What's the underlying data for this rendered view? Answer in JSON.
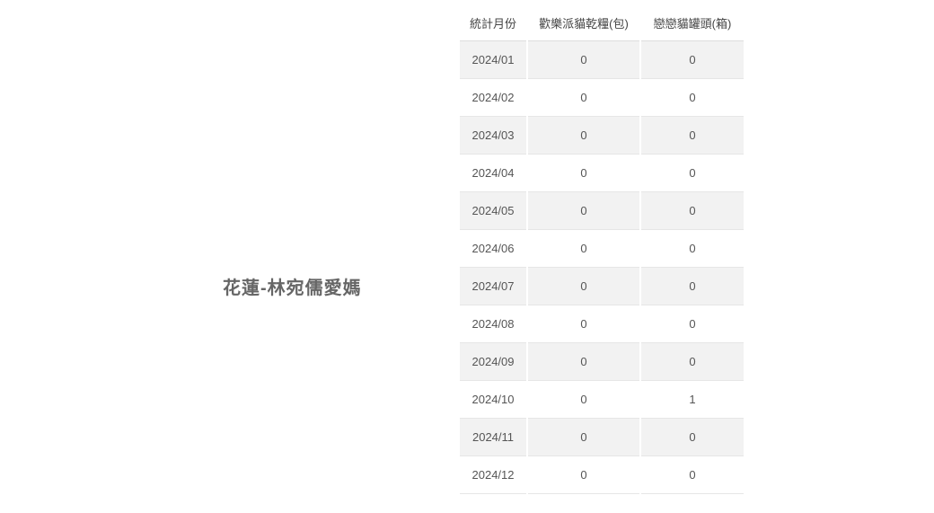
{
  "donor": {
    "name": "花蓮-林宛儒愛媽"
  },
  "table": {
    "headers": {
      "month": "統計月份",
      "dry_food": "歡樂派貓乾糧(包)",
      "canned": "戀戀貓罐頭(箱)"
    },
    "rows": [
      {
        "month": "2024/01",
        "dry_food": "0",
        "canned": "0"
      },
      {
        "month": "2024/02",
        "dry_food": "0",
        "canned": "0"
      },
      {
        "month": "2024/03",
        "dry_food": "0",
        "canned": "0"
      },
      {
        "month": "2024/04",
        "dry_food": "0",
        "canned": "0"
      },
      {
        "month": "2024/05",
        "dry_food": "0",
        "canned": "0"
      },
      {
        "month": "2024/06",
        "dry_food": "0",
        "canned": "0"
      },
      {
        "month": "2024/07",
        "dry_food": "0",
        "canned": "0"
      },
      {
        "month": "2024/08",
        "dry_food": "0",
        "canned": "0"
      },
      {
        "month": "2024/09",
        "dry_food": "0",
        "canned": "0"
      },
      {
        "month": "2024/10",
        "dry_food": "0",
        "canned": "1"
      },
      {
        "month": "2024/11",
        "dry_food": "0",
        "canned": "0"
      },
      {
        "month": "2024/12",
        "dry_food": "0",
        "canned": "0"
      }
    ]
  },
  "colors": {
    "shaded_row": "#f2f2f2",
    "text": "#555555"
  }
}
